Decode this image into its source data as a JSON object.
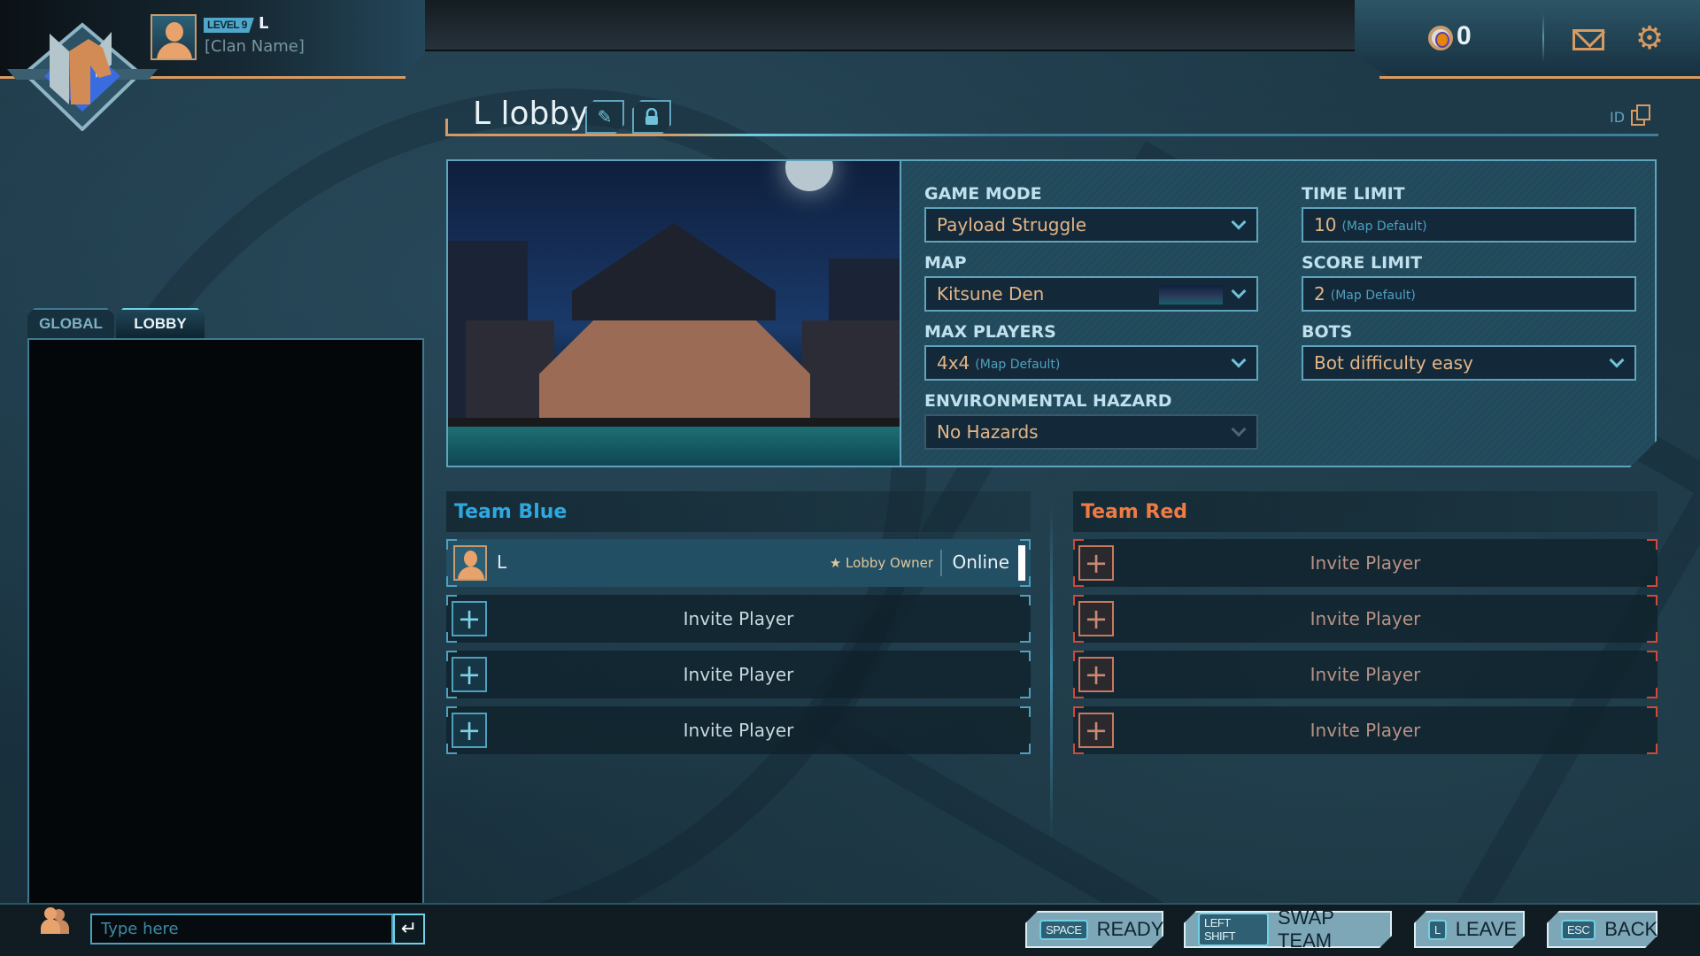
{
  "profile": {
    "level": "LEVEL 9",
    "name": "L",
    "clan": "[Clan Name]"
  },
  "currency": {
    "value": "0"
  },
  "lobby": {
    "title": "L lobby",
    "id_label": "ID"
  },
  "settings": {
    "game_mode": {
      "label": "GAME MODE",
      "value": "Payload Struggle"
    },
    "map": {
      "label": "MAP",
      "value": "Kitsune Den"
    },
    "max_players": {
      "label": "MAX PLAYERS",
      "value": "4x4",
      "note": "(Map Default)"
    },
    "hazard": {
      "label": "ENVIRONMENTAL HAZARD",
      "value": "No Hazards"
    },
    "time_limit": {
      "label": "TIME LIMIT",
      "value": "10",
      "note": "(Map Default)"
    },
    "score_limit": {
      "label": "SCORE LIMIT",
      "value": "2",
      "note": "(Map Default)"
    },
    "bots": {
      "label": "BOTS",
      "value": "Bot difficulty easy"
    }
  },
  "teams": {
    "blue": {
      "name": "Team Blue",
      "player": {
        "name": "L",
        "role": "★ Lobby Owner",
        "status": "Online"
      },
      "invite_label": "Invite Player"
    },
    "red": {
      "name": "Team Red",
      "invite_label": "Invite Player"
    }
  },
  "chat": {
    "tabs": [
      {
        "label": "GLOBAL"
      },
      {
        "label": "LOBBY"
      }
    ],
    "placeholder": "Type here"
  },
  "actions": [
    {
      "key": "SPACE",
      "label": "READY"
    },
    {
      "key": "LEFT SHIFT",
      "label": "SWAP TEAM"
    },
    {
      "key": "L",
      "label": "LEAVE"
    },
    {
      "key": "ESC",
      "label": "BACK"
    }
  ],
  "icons": {
    "edit": "pencil-icon",
    "lock": "lock-icon",
    "copy": "copy-icon",
    "mail": "mail-icon",
    "settings": "gear-icon",
    "send": "enter-icon",
    "friends": "friends-icon"
  }
}
